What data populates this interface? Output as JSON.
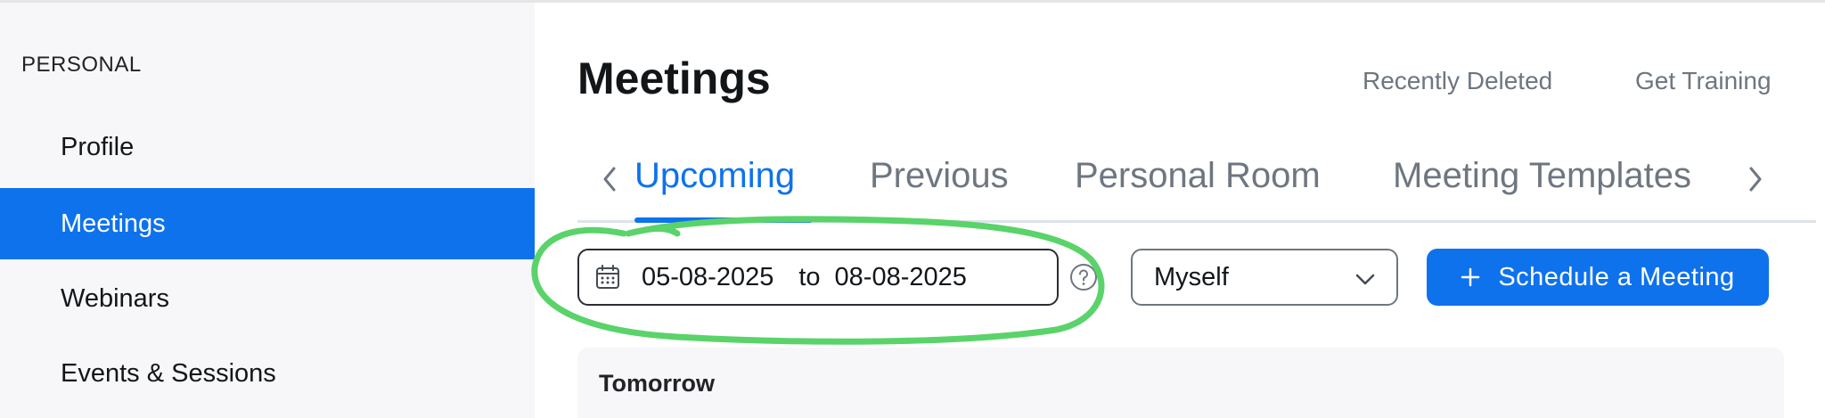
{
  "sidebar": {
    "section_label": "PERSONAL",
    "items": [
      {
        "label": "Profile"
      },
      {
        "label": "Meetings"
      },
      {
        "label": "Webinars"
      },
      {
        "label": "Events & Sessions"
      }
    ]
  },
  "header": {
    "title": "Meetings",
    "links": {
      "recently_deleted": "Recently Deleted",
      "get_training": "Get Training"
    }
  },
  "tabs": [
    {
      "label": "Upcoming",
      "active": true
    },
    {
      "label": "Previous",
      "active": false
    },
    {
      "label": "Personal Room",
      "active": false
    },
    {
      "label": "Meeting Templates",
      "active": false
    }
  ],
  "filters": {
    "date_from": "05-08-2025",
    "date_separator": "to",
    "date_to": "08-08-2025",
    "host_select": "Myself"
  },
  "actions": {
    "schedule_label": "Schedule a Meeting"
  },
  "groups": [
    {
      "title": "Tomorrow"
    }
  ],
  "colors": {
    "accent": "#0e72ed",
    "sidebar_bg": "#f7f7f9",
    "annotation": "#5ad36a",
    "muted_text": "#6e7680"
  },
  "icons": {
    "calendar": "calendar-icon",
    "help": "help-icon",
    "chevron_left": "chevron-left-icon",
    "chevron_right": "chevron-right-icon",
    "chevron_down": "chevron-down-icon",
    "plus": "plus-icon"
  }
}
